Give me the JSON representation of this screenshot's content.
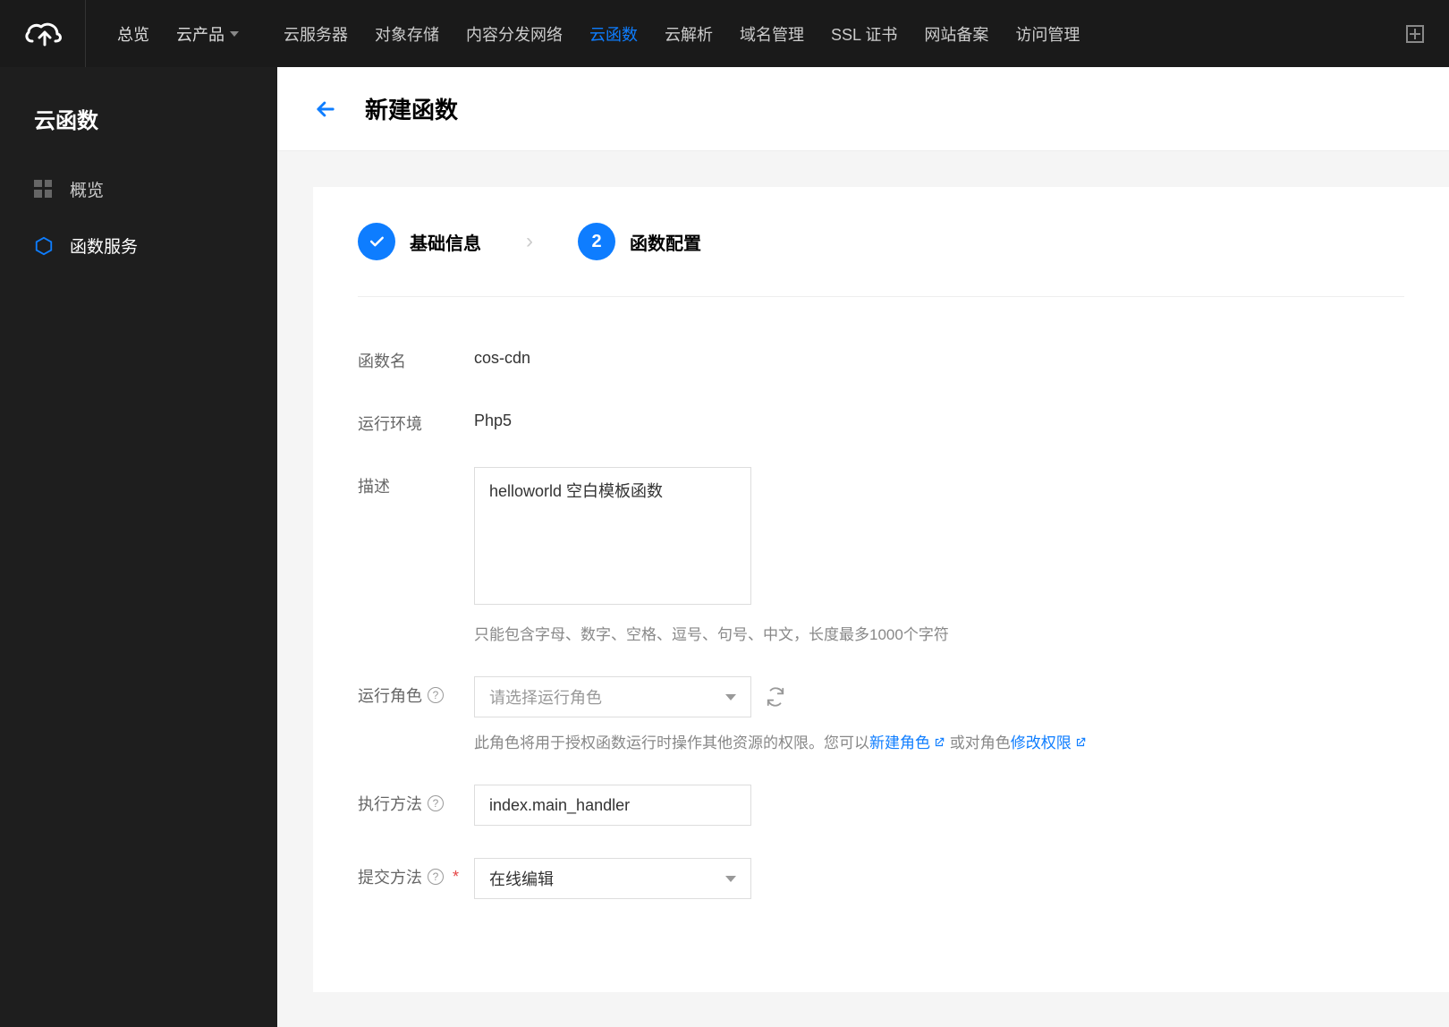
{
  "header": {
    "nav_primary": {
      "overview": "总览",
      "cloud_products": "云产品"
    },
    "nav_secondary": [
      {
        "label": "云服务器",
        "active": false
      },
      {
        "label": "对象存储",
        "active": false
      },
      {
        "label": "内容分发网络",
        "active": false
      },
      {
        "label": "云函数",
        "active": true
      },
      {
        "label": "云解析",
        "active": false
      },
      {
        "label": "域名管理",
        "active": false
      },
      {
        "label": "SSL 证书",
        "active": false
      },
      {
        "label": "网站备案",
        "active": false
      },
      {
        "label": "访问管理",
        "active": false
      }
    ]
  },
  "sidebar": {
    "title": "云函数",
    "items": [
      {
        "label": "概览",
        "icon": "grid",
        "active": false
      },
      {
        "label": "函数服务",
        "icon": "hexagon",
        "active": true
      }
    ]
  },
  "page": {
    "title": "新建函数"
  },
  "steps": {
    "step1": {
      "label": "基础信息",
      "completed": true
    },
    "step2": {
      "number": "2",
      "label": "函数配置"
    }
  },
  "form": {
    "function_name": {
      "label": "函数名",
      "value": "cos-cdn"
    },
    "runtime": {
      "label": "运行环境",
      "value": "Php5"
    },
    "description": {
      "label": "描述",
      "value": "helloworld 空白模板函数",
      "help": "只能包含字母、数字、空格、逗号、句号、中文，长度最多1000个字符"
    },
    "role": {
      "label": "运行角色",
      "placeholder": "请选择运行角色",
      "help_prefix": "此角色将用于授权函数运行时操作其他资源的权限。您可以",
      "link1": "新建角色",
      "help_mid": " 或对角色",
      "link2": "修改权限"
    },
    "handler": {
      "label": "执行方法",
      "value": "index.main_handler"
    },
    "submit_method": {
      "label": "提交方法",
      "required": true,
      "value": "在线编辑"
    }
  }
}
